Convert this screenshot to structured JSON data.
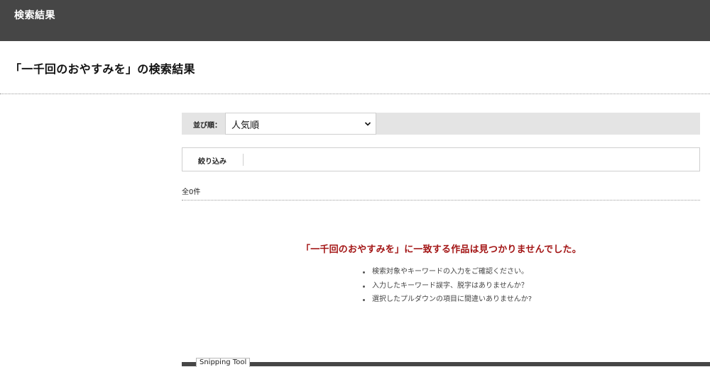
{
  "header": {
    "title": "検索結果"
  },
  "page": {
    "heading": "「一千回のおやすみを」の検索結果"
  },
  "sort": {
    "label": "並び順：",
    "selected": "人気順"
  },
  "filter": {
    "label": "絞り込み"
  },
  "results": {
    "count_text": "全0件",
    "no_result_message": "「一千回のおやすみを」に一致する作品は見つかりませんでした。",
    "tips": [
      "検索対象やキーワードの入力をご確認ください。",
      "入力したキーワード誤字、脱字はありませんか？",
      "選択したプルダウンの項目に間違いありませんか?"
    ]
  },
  "overlay": {
    "snipping_tool_label": "Snipping Tool"
  },
  "colors": {
    "header_bg": "#464646",
    "sort_bar_bg": "#e4e4e4",
    "no_result_red": "#a31515"
  },
  "icons": {
    "sort_dropdown": "chevron-down-icon"
  }
}
